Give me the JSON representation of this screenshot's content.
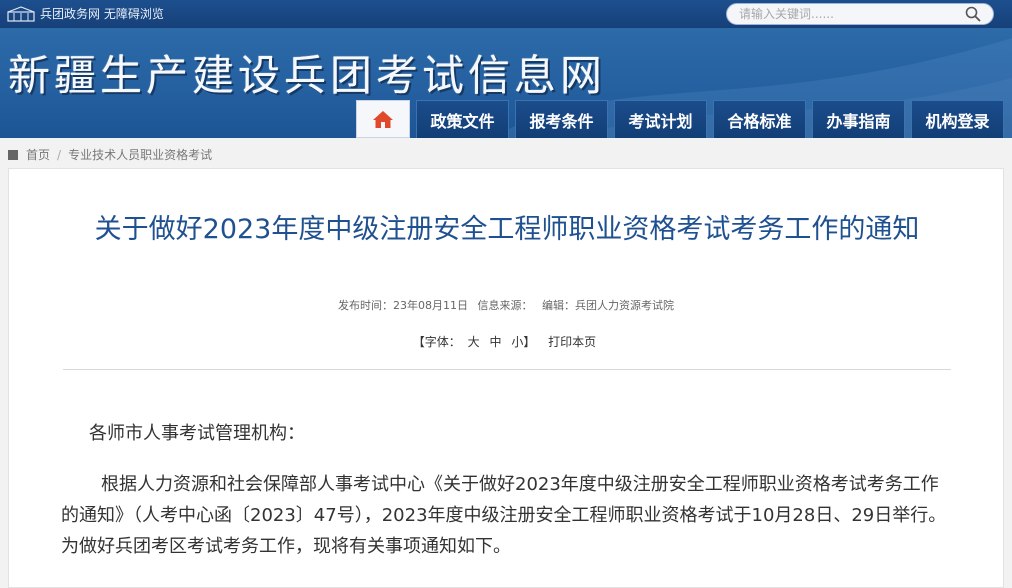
{
  "topbar": {
    "links_text": "兵团政务网 无障碍浏览",
    "search_placeholder": "请输入关键词......"
  },
  "banner": {
    "site_title": "新疆生产建设兵团考试信息网"
  },
  "nav": {
    "items": [
      "政策文件",
      "报考条件",
      "考试计划",
      "合格标准",
      "办事指南",
      "机构登录"
    ]
  },
  "breadcrumb": {
    "home": "首页",
    "sep": "/",
    "current": "专业技术人员职业资格考试"
  },
  "article": {
    "title": "关于做好2023年度中级注册安全工程师职业资格考试考务工作的通知",
    "publish_time": "发布时间：23年08月11日",
    "source": "信息来源：",
    "editor": "编辑：兵团人力资源考试院",
    "font_label": "【字体：",
    "font_large": "大",
    "font_medium": "中",
    "font_small": "小】",
    "print": "打印本页",
    "greeting": "各师市人事考试管理机构：",
    "paragraph": "根据人力资源和社会保障部人事考试中心《关于做好2023年度中级注册安全工程师职业资格考试考务工作的通知》（人考中心函〔2023〕47号），2023年度中级注册安全工程师职业资格考试于10月28日、29日举行。为做好兵团考区考试考务工作，现将有关事项通知如下。"
  },
  "colors": {
    "brand_blue": "#1f5191",
    "nav_bg": "#123e76",
    "topbar_bg": "#164079"
  }
}
